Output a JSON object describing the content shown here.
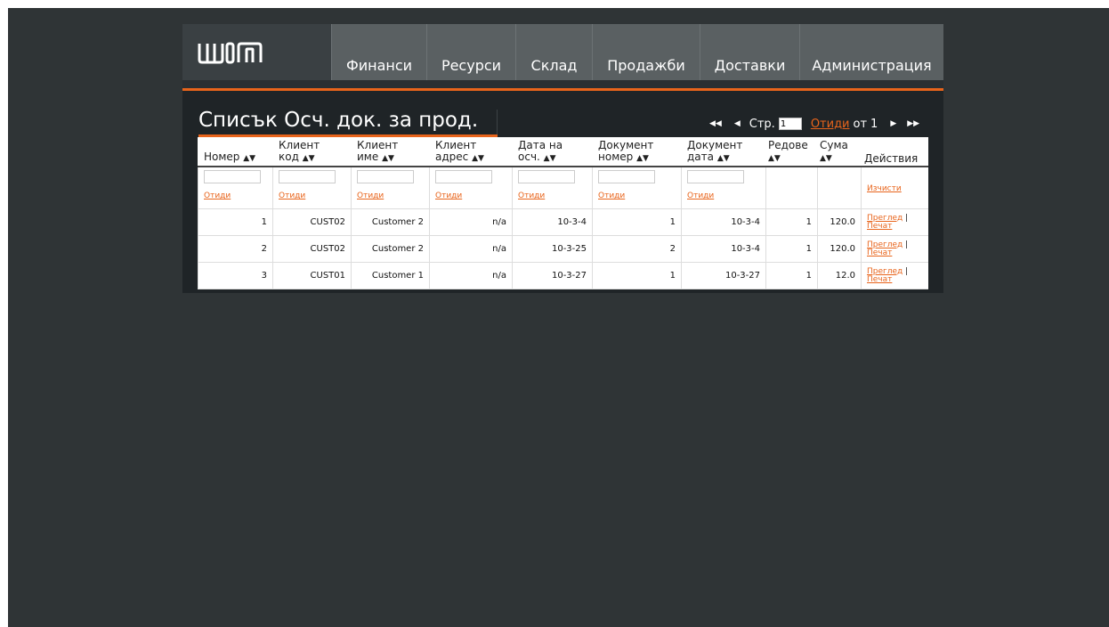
{
  "nav": [
    "Финанси",
    "Ресурси",
    "Склад",
    "Продажби",
    "Доставки",
    "Администрация"
  ],
  "page_title": "Списък Осч. док. за прод.",
  "pager": {
    "page_label": "Стр.",
    "page_value": "1",
    "go_label": "Отиди",
    "of_label": "от",
    "total_pages": "1",
    "icons": [
      "first-page-icon",
      "prev-page-icon",
      "next-page-icon",
      "last-page-icon"
    ]
  },
  "columns": [
    {
      "line1": "Номер",
      "line2": ""
    },
    {
      "line1": "Клиент",
      "line2": "код"
    },
    {
      "line1": "Клиент",
      "line2": "име"
    },
    {
      "line1": "Клиент",
      "line2": "адрес"
    },
    {
      "line1": "Дата на",
      "line2": "осч."
    },
    {
      "line1": "Документ",
      "line2": "номер"
    },
    {
      "line1": "Документ",
      "line2": "дата"
    },
    {
      "line1": "Редове",
      "line2": ""
    },
    {
      "line1": "Сума",
      "line2": ""
    },
    {
      "line1": "Действия",
      "line2": ""
    }
  ],
  "filter": {
    "go_label": "Отиди",
    "clear_label": "Изчисти"
  },
  "rows": [
    {
      "number": "1",
      "client_code": "CUST02",
      "client_name": "Customer 2",
      "client_address": "n/a",
      "date": "10-3-4",
      "doc_number": "1",
      "doc_date": "10-3-4",
      "lines": "1",
      "sum": "120.0"
    },
    {
      "number": "2",
      "client_code": "CUST02",
      "client_name": "Customer 2",
      "client_address": "n/a",
      "date": "10-3-25",
      "doc_number": "2",
      "doc_date": "10-3-4",
      "lines": "1",
      "sum": "120.0"
    },
    {
      "number": "3",
      "client_code": "CUST01",
      "client_name": "Customer 1",
      "client_address": "n/a",
      "date": "10-3-27",
      "doc_number": "1",
      "doc_date": "10-3-27",
      "lines": "1",
      "sum": "12.0"
    }
  ],
  "actions": {
    "view": "Преглед",
    "sep": "|",
    "print": "Печат"
  },
  "colors": {
    "accent": "#e8641b",
    "background": "#2f3436",
    "panel": "#1f2427",
    "nav": "#5a6062"
  }
}
